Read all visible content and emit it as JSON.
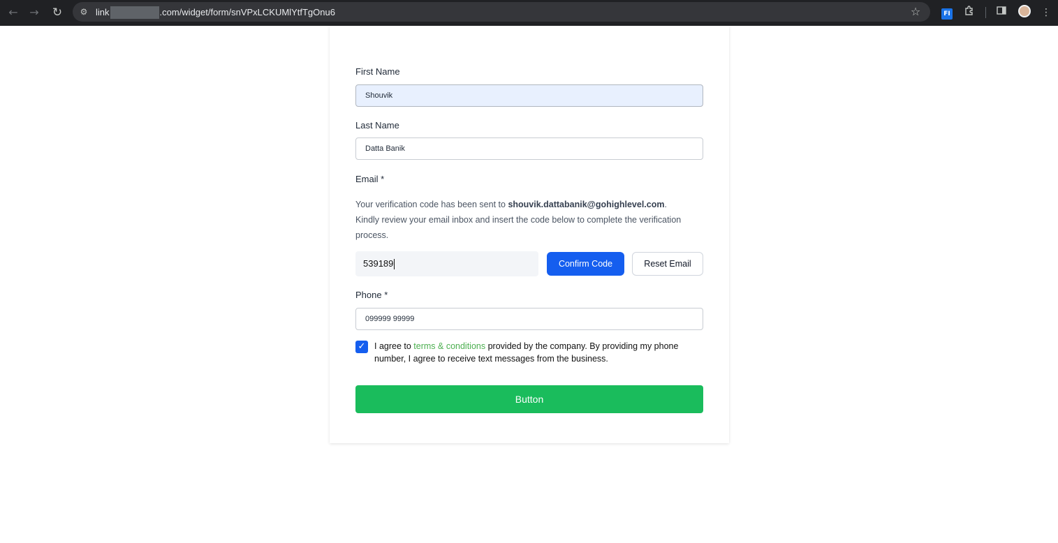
{
  "browser": {
    "url_prefix": "link",
    "url_suffix": ".com/widget/form/snVPxLCKUMlYtfTgOnu6",
    "back_glyph": "←",
    "forward_glyph": "→",
    "reload_glyph": "↻",
    "star_glyph": "☆",
    "extension_label": "FI",
    "menu_glyph": "⋮"
  },
  "form": {
    "first_name_label": "First Name",
    "first_name_value": "Shouvik",
    "last_name_label": "Last Name",
    "last_name_value": "Datta Banik",
    "email_label": "Email *",
    "verification_text_1": "Your verification code has been sent to ",
    "verification_email": "shouvik.dattabanik@gohighlevel.com",
    "verification_text_2": ".",
    "verification_text_3": "Kindly review your email inbox and insert the code below to complete the verification process.",
    "code_value": "539189",
    "confirm_label": "Confirm Code",
    "reset_label": "Reset Email",
    "phone_label": "Phone *",
    "phone_value": "099999 99999",
    "consent_prefix": "I agree to ",
    "consent_link": "terms & conditions",
    "consent_suffix": " provided by the company. By providing my phone number, I agree to receive text messages from the business.",
    "submit_label": "Button"
  },
  "colors": {
    "primary": "#155eef",
    "submit": "#1abc5c",
    "link": "#4caf50"
  }
}
